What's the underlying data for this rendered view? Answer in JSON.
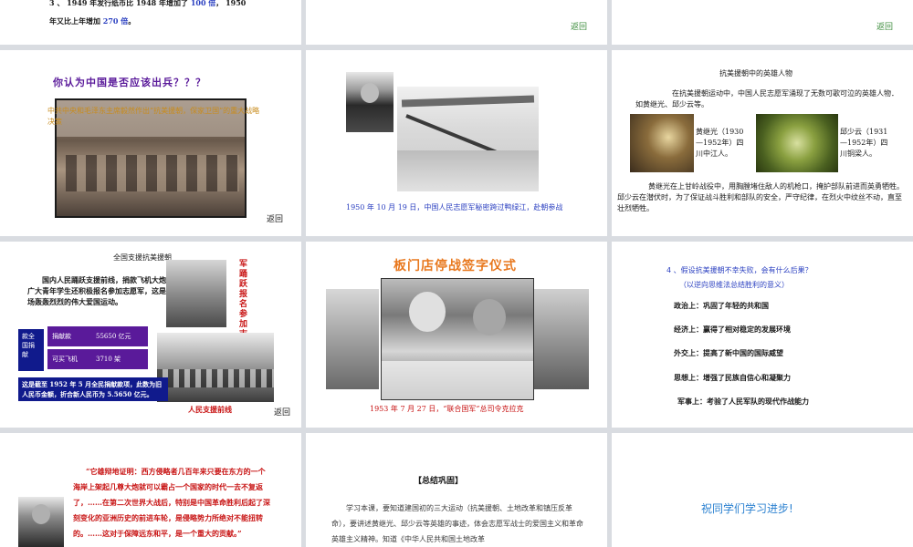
{
  "s1": {
    "line1": "3 、 1949 年发行纸币比 1948 年增加了 ",
    "line1_hl": "100 倍",
    "line1_tail": "，  1950",
    "line2": "年又比上年增加 ",
    "line2_hl": "270 倍",
    "line2_tail": "。"
  },
  "s2": {
    "back": "返回"
  },
  "s3": {
    "back": "返回"
  },
  "s4": {
    "title": "你认为中国是否应该出兵？？？",
    "caption": "中共中央和毛泽东主席毅然作出“抗美援朝，保家卫国”的重大战略决策",
    "back": "返回"
  },
  "s5": {
    "caption": "1950 年 10 月 19 日，中国人民志愿军秘密跨过鸭绿江，赴朝参战"
  },
  "s6": {
    "title": "抗美援朝中的英雄人物",
    "intro": "在抗美援朝运动中，中国人民志愿军涌现了无数可歌可泣的英雄人物．如黄继光、邱少云等。",
    "hero1": "黄继光（1930—1952年）四川中江人。",
    "hero2": "邱少云（1931—1952年）四川铜梁人。",
    "story": "黄继光在上甘岭战役中，用胸膛堵住敌人的机枪口，掩护部队前进而英勇牺牲。        邱少云在潜伏时，为了保证战斗胜利和部队的安全，严守纪律，在烈火中纹丝不动，直至壮烈牺牲。"
  },
  "s7": {
    "title": "全国支援抗美援朝",
    "body": "国内人民踊跃支援前线，捐款飞机大炮，广大青年学生还积极报名参加志愿军，这是一场轰轰烈烈的伟大爱国运动。",
    "vertical": "军踊跃报名参加志愿",
    "table_label": "款全国捐献",
    "rows": [
      {
        "k": "捐献款",
        "v": "55650 亿元"
      },
      {
        "k": "可买飞机",
        "v": "3710 架"
      }
    ],
    "note": "这是截至 1952 年 5 月全民捐献款项，此数为旧人民币金额，折合新人民币为 5.5650 亿元。",
    "photo_caption": "人民支援前线",
    "back": "返回"
  },
  "s8": {
    "title": "板门店停战签字仪式",
    "caption": "1953 年 7 月 27 日，“联合国军”总司令克拉克"
  },
  "s9": {
    "question": "4 、假设抗美援朝不幸失败，会有什么后果？",
    "hint": "（以逆向思维法总结胜利的意义）",
    "items": [
      "政治上：巩固了年轻的共和国",
      "经济上：赢得了相对稳定的发展环境",
      "外交上：提高了新中国的国际威望",
      "思想上：增强了民族自信心和凝聚力",
      "军事上：考验了人民军队的现代作战能力"
    ]
  },
  "s10": {
    "quote": "“它雄辩地证明：西方侵略者几百年来只要在东方的一个海岸上架起几尊大炮就可以霸占一个国家的时代一去不复返了，……在第二次世界大战后，特别是中国革命胜利后起了深刻变化的亚洲历史的前进车轮，是侵略势力所绝对不能扭转的。……这对于保障远东和平，是一个重大的贡献。”"
  },
  "s11": {
    "title": "【总结巩固】",
    "body": "学习本课，要知道建国初的三大运动（抗美援朝、土地改革和镇压反革命），要讲述黄继光、邱少云等英雄的事迹，体会志愿军战士的爱国主义和革命英雄主义精神。知道《中华人民共和国土地改革"
  },
  "s12": {
    "text": "祝同学们学习进步!"
  },
  "colors": {
    "blue": "#2a3fc0",
    "red": "#c81414",
    "purple": "#5a1a9a",
    "navy": "#101a8c"
  }
}
